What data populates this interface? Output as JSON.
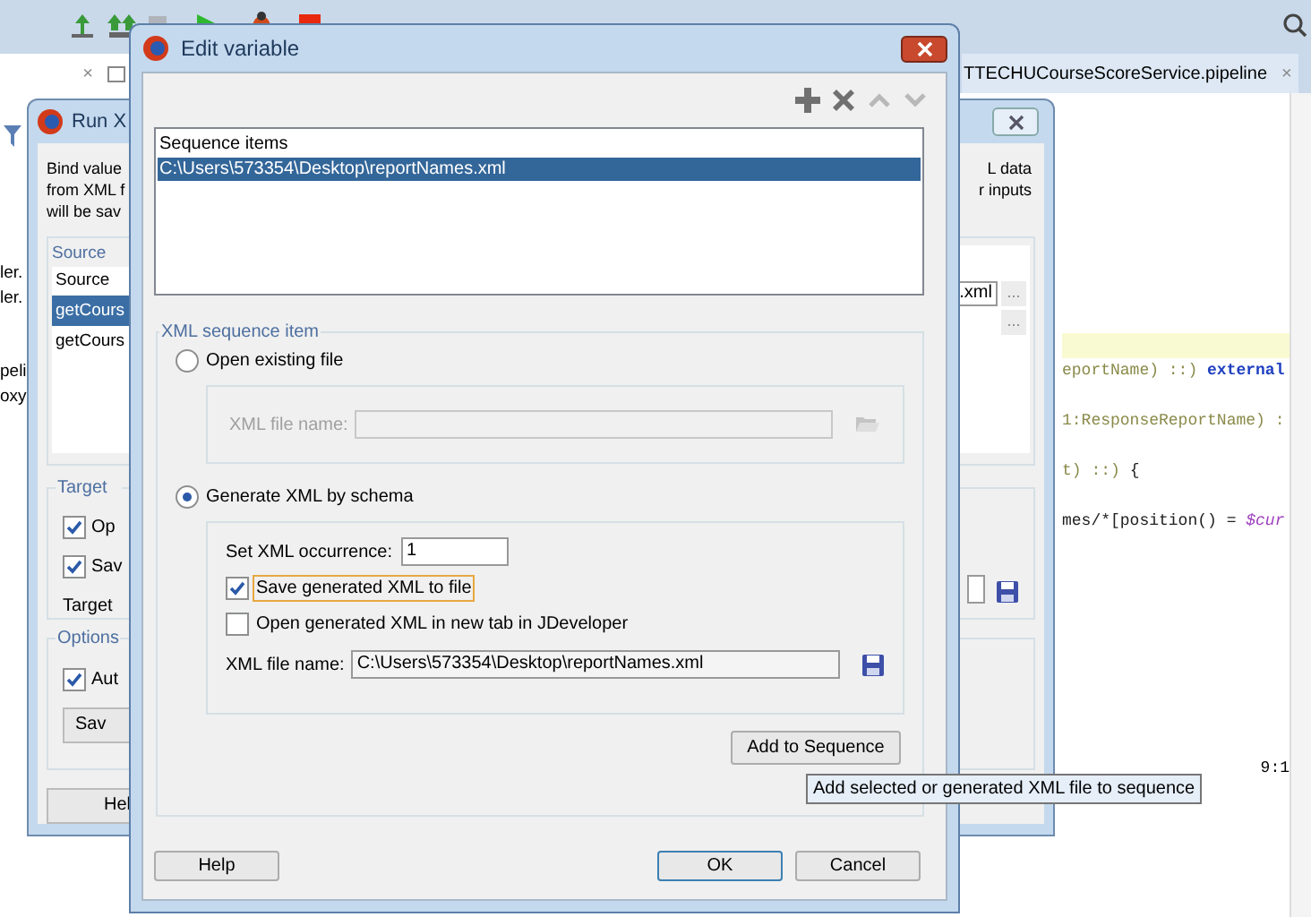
{
  "ide": {
    "left_tab": {
      "close": "×"
    },
    "editor_tab": {
      "label": "TTECHUCourseScoreService.pipeline",
      "close": "×"
    },
    "navigator_items": [
      "ler.",
      "ler.",
      "peli",
      "oxy"
    ],
    "code_lines": [
      {
        "highlighted": true
      },
      {
        "highlighted": false,
        "segments": [
          {
            "kind": "comment",
            "text": "eportName) ::) "
          },
          {
            "kind": "keyword",
            "text": "external"
          }
        ]
      },
      {
        "highlighted": false
      },
      {
        "highlighted": false,
        "segments": [
          {
            "kind": "comment",
            "text": "1:ResponseReportName) :"
          }
        ]
      },
      {
        "highlighted": false
      },
      {
        "highlighted": false,
        "segments": [
          {
            "kind": "comment",
            "text": "t) ::) "
          },
          {
            "kind": "plain",
            "text": "{"
          }
        ]
      },
      {
        "highlighted": false
      },
      {
        "highlighted": false,
        "segments": [
          {
            "kind": "plain",
            "text": "mes/*[position() = "
          },
          {
            "kind": "variable",
            "text": "$cur"
          }
        ]
      }
    ],
    "cursor_position": "9:1"
  },
  "run_dialog": {
    "title": "Run X",
    "intro_left": [
      "Bind value",
      "from XML f",
      "will be sav"
    ],
    "intro_right": [
      "L data",
      "r inputs"
    ],
    "source_group": {
      "legend": "Source",
      "header": "Source",
      "rows": [
        {
          "label": "getCours",
          "selected": true
        },
        {
          "label": "getCours",
          "selected": false
        }
      ]
    },
    "file_cells": [
      {
        "value": ".xml",
        "button": "..."
      },
      {
        "button": "..."
      }
    ],
    "target_group": {
      "legend": "Target",
      "checks": [
        {
          "label": "Op",
          "checked": true
        },
        {
          "label": "Sav",
          "checked": true
        }
      ],
      "label": "Target"
    },
    "options_group": {
      "legend": "Options",
      "checks": [
        {
          "label": "Aut",
          "checked": true
        }
      ],
      "button": "Sav"
    },
    "help_button": "Hel"
  },
  "edit_dialog": {
    "title": "Edit variable",
    "list": {
      "header": "Sequence items",
      "items": [
        {
          "label": "C:\\Users\\573354\\Desktop\\reportNames.xml",
          "selected": true
        }
      ]
    },
    "group_legend": "XML sequence item",
    "open_option": {
      "label": "Open existing file",
      "selected": false,
      "file_label": "XML file name:"
    },
    "generate_option": {
      "label": "Generate XML by schema",
      "selected": true,
      "occurrence_label": "Set XML occurrence:",
      "occurrence": "1",
      "checks": [
        {
          "label": "Save generated XML to file",
          "checked": true,
          "focused": true
        },
        {
          "label": "Open generated XML in new tab in JDeveloper",
          "checked": false,
          "focused": false
        }
      ],
      "file_label": "XML file name:",
      "file_value": "C:\\Users\\573354\\Desktop\\reportNames.xml"
    },
    "add_button": "Add to Sequence",
    "buttons": [
      {
        "label": "Help",
        "default": false
      },
      {
        "label": "OK",
        "default": true
      },
      {
        "label": "Cancel",
        "default": false
      }
    ]
  },
  "tooltip": "Add selected or generated XML file to sequence"
}
